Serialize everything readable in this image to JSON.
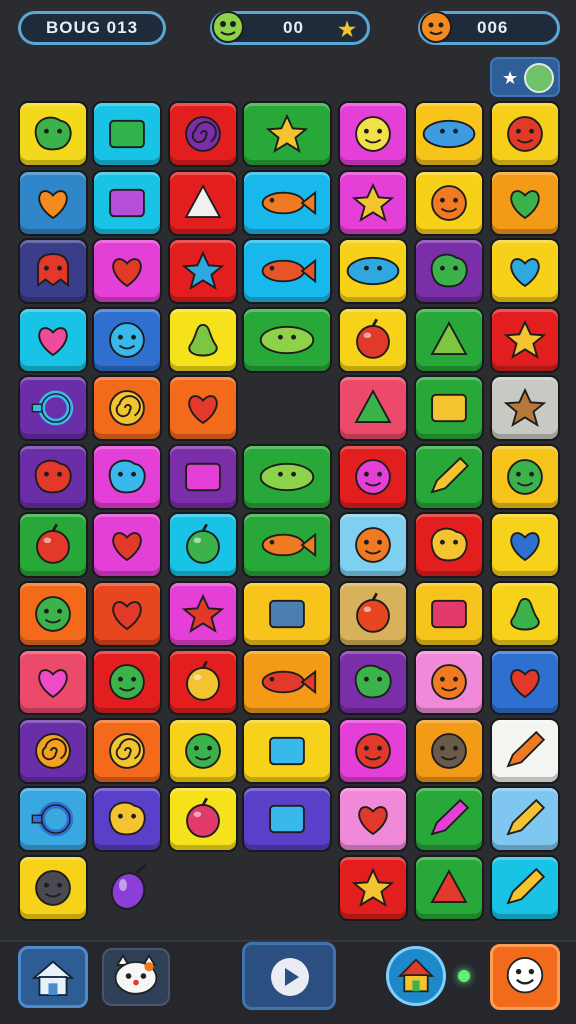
{
  "header": {
    "title": "BOUG 013",
    "moves_value": "00",
    "score_value": "006"
  },
  "header_icons": {
    "moves": "green-creature-icon",
    "star": "star-icon",
    "score": "orange-creature-icon",
    "mini_button": "star-and-globe-icon"
  },
  "board": {
    "columns": 7,
    "rows": 13,
    "tiles": [
      {
        "row": 0,
        "col": 0,
        "color": "#f2d91b",
        "icon": "pea-pod-icon",
        "shape": "blob",
        "fg": "#3cb34a"
      },
      {
        "row": 0,
        "col": 1,
        "color": "#19c3e6",
        "icon": "grass-icon",
        "shape": "rect",
        "fg": "#2fb34a"
      },
      {
        "row": 0,
        "col": 2,
        "color": "#e21e1e",
        "icon": "swirl-icon",
        "shape": "swirl",
        "fg": "#7a2fa8"
      },
      {
        "row": 0,
        "col": 3,
        "color": "#28a838",
        "icon": "shooting-star-icon",
        "shape": "star",
        "fg": "#f4c430",
        "wide": true
      },
      {
        "row": 0,
        "col": 4,
        "color": "#e43fd6",
        "icon": "smiley-face-icon",
        "shape": "face",
        "fg": "#f2e04a"
      },
      {
        "row": 0,
        "col": 5,
        "color": "#f7c41a",
        "icon": "dish-icon",
        "shape": "oval",
        "fg": "#3d9be0"
      },
      {
        "row": 0,
        "col": 6,
        "color": "#f6cf1a",
        "icon": "red-creature-icon",
        "shape": "face",
        "fg": "#e23a2a"
      },
      {
        "row": 1,
        "col": 0,
        "color": "#2f86c9",
        "icon": "orange-heart-icon",
        "shape": "heart",
        "fg": "#f58b1e"
      },
      {
        "row": 1,
        "col": 1,
        "color": "#19c3e6",
        "icon": "purple-cube-icon",
        "shape": "rect",
        "fg": "#b64fd8"
      },
      {
        "row": 1,
        "col": 2,
        "color": "#e21e1e",
        "icon": "shark-fin-icon",
        "shape": "triangle",
        "fg": "#f0f0f0"
      },
      {
        "row": 1,
        "col": 3,
        "color": "#19b8ec",
        "icon": "orange-fish-icon",
        "shape": "fish",
        "fg": "#f07a22",
        "wide": true
      },
      {
        "row": 1,
        "col": 4,
        "color": "#e43fd6",
        "icon": "star-icon",
        "shape": "star",
        "fg": "#f4c430"
      },
      {
        "row": 1,
        "col": 5,
        "color": "#f7d01a",
        "icon": "bear-face-icon",
        "shape": "face",
        "fg": "#f07a22"
      },
      {
        "row": 1,
        "col": 6,
        "color": "#f39b17",
        "icon": "green-leaf-heart-icon",
        "shape": "heart",
        "fg": "#3cb34a"
      },
      {
        "row": 2,
        "col": 0,
        "color": "#3a3e8a",
        "icon": "red-ghost-icon",
        "shape": "ghost",
        "fg": "#e23a2a"
      },
      {
        "row": 2,
        "col": 1,
        "color": "#e43fd6",
        "icon": "red-heart-icon",
        "shape": "heart",
        "fg": "#e23a2a"
      },
      {
        "row": 2,
        "col": 2,
        "color": "#e21e1e",
        "icon": "blue-splash-icon",
        "shape": "star",
        "fg": "#2fa8e0"
      },
      {
        "row": 2,
        "col": 3,
        "color": "#19b8ec",
        "icon": "red-fish-icon",
        "shape": "fish",
        "fg": "#e8542a",
        "wide": true
      },
      {
        "row": 2,
        "col": 4,
        "color": "#f7d01a",
        "icon": "blue-blob-icon",
        "shape": "oval",
        "fg": "#2fa8e0"
      },
      {
        "row": 2,
        "col": 5,
        "color": "#7a2fa8",
        "icon": "green-blob-icon",
        "shape": "blob",
        "fg": "#3cb34a"
      },
      {
        "row": 2,
        "col": 6,
        "color": "#f7d01a",
        "icon": "blue-heart-icon",
        "shape": "heart",
        "fg": "#2fa8e0"
      },
      {
        "row": 3,
        "col": 0,
        "color": "#19c3e6",
        "icon": "pink-heart-icon",
        "shape": "heart",
        "fg": "#f04a9b"
      },
      {
        "row": 3,
        "col": 1,
        "color": "#2f6fd0",
        "icon": "blue-smiley-icon",
        "shape": "face",
        "fg": "#39b8ec"
      },
      {
        "row": 3,
        "col": 2,
        "color": "#f6e21a",
        "icon": "pear-icon",
        "shape": "pear",
        "fg": "#7cc642"
      },
      {
        "row": 3,
        "col": 3,
        "color": "#28a838",
        "icon": "green-bean-icon",
        "shape": "oval",
        "fg": "#8ed24a",
        "wide": true
      },
      {
        "row": 3,
        "col": 4,
        "color": "#f6d21a",
        "icon": "tomato-icon",
        "shape": "circle",
        "fg": "#e23a2a"
      },
      {
        "row": 3,
        "col": 5,
        "color": "#28a838",
        "icon": "leaf-icon",
        "shape": "triangle",
        "fg": "#7cc642"
      },
      {
        "row": 3,
        "col": 6,
        "color": "#e21e1e",
        "icon": "yellow-splat-icon",
        "shape": "star",
        "fg": "#f4c430"
      },
      {
        "row": 4,
        "col": 0,
        "color": "#6a2fa8",
        "icon": "magnifier-icon",
        "shape": "ring",
        "fg": "#39b8ec"
      },
      {
        "row": 4,
        "col": 1,
        "color": "#f36a1b",
        "icon": "orange-swirl-icon",
        "shape": "swirl",
        "fg": "#f4c430"
      },
      {
        "row": 4,
        "col": 2,
        "color": "#f36a1b",
        "icon": "heart-face-icon",
        "shape": "heart",
        "fg": "#e23a2a"
      },
      {
        "row": 4,
        "col": 4,
        "color": "#ec4a6a",
        "icon": "green-arrow-icon",
        "shape": "triangle",
        "fg": "#3cb34a"
      },
      {
        "row": 4,
        "col": 5,
        "color": "#28a838",
        "icon": "yellow-tag-icon",
        "shape": "rect",
        "fg": "#f4c430"
      },
      {
        "row": 4,
        "col": 6,
        "color": "#c9c9c4",
        "icon": "cookie-icon",
        "shape": "star",
        "fg": "#b57a3a"
      },
      {
        "row": 5,
        "col": 0,
        "color": "#6a2fa8",
        "icon": "red-bird-icon",
        "shape": "blob",
        "fg": "#e23a2a"
      },
      {
        "row": 5,
        "col": 1,
        "color": "#e43fd6",
        "icon": "cloud-icon",
        "shape": "blob",
        "fg": "#39b8ec"
      },
      {
        "row": 5,
        "col": 2,
        "color": "#7a2fa8",
        "icon": "crown-icon",
        "shape": "rect",
        "fg": "#e43fd6"
      },
      {
        "row": 5,
        "col": 3,
        "color": "#28a838",
        "icon": "green-bean-icon",
        "shape": "oval",
        "fg": "#8ed24a",
        "wide": true
      },
      {
        "row": 5,
        "col": 4,
        "color": "#e21e1e",
        "icon": "pink-face-icon",
        "shape": "face",
        "fg": "#e43fd6"
      },
      {
        "row": 5,
        "col": 5,
        "color": "#28a838",
        "icon": "pencil-icon",
        "shape": "pencil",
        "fg": "#f4c430"
      },
      {
        "row": 5,
        "col": 6,
        "color": "#f6c41a",
        "icon": "frog-face-icon",
        "shape": "face",
        "fg": "#3cb34a"
      },
      {
        "row": 6,
        "col": 0,
        "color": "#28a838",
        "icon": "strawberry-icon",
        "shape": "circle",
        "fg": "#e23a2a"
      },
      {
        "row": 6,
        "col": 1,
        "color": "#e43fd6",
        "icon": "red-heart-icon",
        "shape": "heart",
        "fg": "#e23a2a"
      },
      {
        "row": 6,
        "col": 2,
        "color": "#19c3e6",
        "icon": "lime-icon",
        "shape": "circle",
        "fg": "#3cb34a"
      },
      {
        "row": 6,
        "col": 3,
        "color": "#28a838",
        "icon": "orange-fish-icon",
        "shape": "fish",
        "fg": "#f07a22",
        "wide": true
      },
      {
        "row": 6,
        "col": 4,
        "color": "#7fd0f0",
        "icon": "orange-face-icon",
        "shape": "face",
        "fg": "#f07a22"
      },
      {
        "row": 6,
        "col": 5,
        "color": "#e21e1e",
        "icon": "golden-fruit-icon",
        "shape": "blob",
        "fg": "#f4c430"
      },
      {
        "row": 6,
        "col": 6,
        "color": "#f6d21a",
        "icon": "blue-heart-icon",
        "shape": "heart",
        "fg": "#2f6fd0"
      },
      {
        "row": 7,
        "col": 0,
        "color": "#f36a1b",
        "icon": "green-frog-icon",
        "shape": "face",
        "fg": "#3cb34a"
      },
      {
        "row": 7,
        "col": 1,
        "color": "#e8461e",
        "icon": "strawberry-icon",
        "shape": "heart",
        "fg": "#e23a2a"
      },
      {
        "row": 7,
        "col": 2,
        "color": "#e43fd6",
        "icon": "red-splat-icon",
        "shape": "star",
        "fg": "#e23a2a"
      },
      {
        "row": 7,
        "col": 3,
        "color": "#f6c41a",
        "icon": "machine-icon",
        "shape": "rect",
        "fg": "#4a7fb0",
        "wide": true
      },
      {
        "row": 7,
        "col": 4,
        "color": "#d8b25a",
        "icon": "tomato-icon",
        "shape": "circle",
        "fg": "#e8461e"
      },
      {
        "row": 7,
        "col": 5,
        "color": "#f6c41a",
        "icon": "jam-jar-icon",
        "shape": "rect",
        "fg": "#e23a6a"
      },
      {
        "row": 7,
        "col": 6,
        "color": "#f6d21a",
        "icon": "cactus-icon",
        "shape": "pear",
        "fg": "#3cb34a"
      },
      {
        "row": 8,
        "col": 0,
        "color": "#ec4a6a",
        "icon": "pink-heart-icon",
        "shape": "heart",
        "fg": "#f04ac8"
      },
      {
        "row": 8,
        "col": 1,
        "color": "#e21e1e",
        "icon": "green-face-icon",
        "shape": "face",
        "fg": "#3cb34a"
      },
      {
        "row": 8,
        "col": 2,
        "color": "#e21e1e",
        "icon": "apple-icon",
        "shape": "circle",
        "fg": "#f4c430"
      },
      {
        "row": 8,
        "col": 3,
        "color": "#f39b17",
        "icon": "shoe-icon",
        "shape": "fish",
        "fg": "#e23a2a",
        "wide": true
      },
      {
        "row": 8,
        "col": 4,
        "color": "#7a2fa8",
        "icon": "green-creature-icon",
        "shape": "blob",
        "fg": "#3cb34a"
      },
      {
        "row": 8,
        "col": 5,
        "color": "#f08ad8",
        "icon": "orange-smiley-icon",
        "shape": "face",
        "fg": "#f07a22"
      },
      {
        "row": 8,
        "col": 6,
        "color": "#2f6fd0",
        "icon": "red-heart-icon",
        "shape": "heart",
        "fg": "#e23a2a"
      },
      {
        "row": 9,
        "col": 0,
        "color": "#6a2fa8",
        "icon": "orange-swirl-icon",
        "shape": "swirl",
        "fg": "#f4a020"
      },
      {
        "row": 9,
        "col": 1,
        "color": "#f36a1b",
        "icon": "orange-swirl-icon",
        "shape": "swirl",
        "fg": "#f4c430"
      },
      {
        "row": 9,
        "col": 2,
        "color": "#f6d21a",
        "icon": "frog-face-icon",
        "shape": "face",
        "fg": "#3cb34a"
      },
      {
        "row": 9,
        "col": 3,
        "color": "#f6d21a",
        "icon": "bottles-icon",
        "shape": "rect",
        "fg": "#39b8ec",
        "wide": true
      },
      {
        "row": 9,
        "col": 4,
        "color": "#e43fd6",
        "icon": "red-face-icon",
        "shape": "face",
        "fg": "#e23a2a"
      },
      {
        "row": 9,
        "col": 5,
        "color": "#f39b17",
        "icon": "bear-face-icon",
        "shape": "face",
        "fg": "#6a5a4a"
      },
      {
        "row": 9,
        "col": 6,
        "color": "#f4f4f0",
        "icon": "pencil-icon",
        "shape": "pencil",
        "fg": "#f07a22"
      },
      {
        "row": 10,
        "col": 0,
        "color": "#39a8e0",
        "icon": "lens-icon",
        "shape": "ring",
        "fg": "#2f6fd0"
      },
      {
        "row": 10,
        "col": 1,
        "color": "#5a3fc8",
        "icon": "yellow-blob-icon",
        "shape": "blob",
        "fg": "#f4c430"
      },
      {
        "row": 10,
        "col": 2,
        "color": "#f6e21a",
        "icon": "plum-icon",
        "shape": "circle",
        "fg": "#e23a6a"
      },
      {
        "row": 10,
        "col": 3,
        "color": "#5a3fc8",
        "icon": "blue-crystal-icon",
        "shape": "rect",
        "fg": "#39b8ec",
        "wide": true
      },
      {
        "row": 10,
        "col": 4,
        "color": "#f08ad8",
        "icon": "red-heart-icon",
        "shape": "heart",
        "fg": "#e23a2a"
      },
      {
        "row": 10,
        "col": 5,
        "color": "#28a838",
        "icon": "lipstick-icon",
        "shape": "pencil",
        "fg": "#e43fd6"
      },
      {
        "row": 10,
        "col": 6,
        "color": "#7fc6f0",
        "icon": "pencil-note-icon",
        "shape": "pencil",
        "fg": "#f4c430"
      },
      {
        "row": 11,
        "col": 0,
        "color": "#f6d21a",
        "icon": "mouse-face-icon",
        "shape": "face",
        "fg": "#4a4a52"
      },
      {
        "row": 11,
        "col": 4,
        "color": "#e21e1e",
        "icon": "yellow-star-icon",
        "shape": "star",
        "fg": "#f4c430"
      },
      {
        "row": 11,
        "col": 5,
        "color": "#28a838",
        "icon": "cone-icon",
        "shape": "triangle",
        "fg": "#e23a2a"
      },
      {
        "row": 11,
        "col": 6,
        "color": "#19c3e6",
        "icon": "pencil-icon",
        "shape": "pencil",
        "fg": "#f4c430"
      }
    ],
    "loose_item": {
      "icon": "purple-berry-icon",
      "color": "#8a3fd8"
    }
  },
  "footer": {
    "home": "home-icon",
    "pet": "cat-face-icon",
    "play": "play-icon",
    "shop": "house-shop-icon",
    "indicator": "status-light-icon",
    "emote": "smiley-face-icon"
  }
}
